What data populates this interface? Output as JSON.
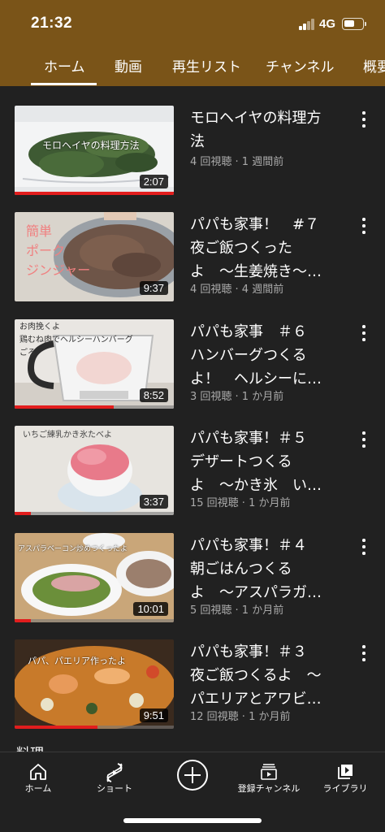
{
  "status_bar": {
    "time": "21:32",
    "network": "4G"
  },
  "tabs": [
    "ホーム",
    "動画",
    "再生リスト",
    "チャンネル",
    "概要"
  ],
  "videos": [
    {
      "title": "モロヘイヤの料理方\n法",
      "meta": "4 回視聴 · 1 週間前",
      "duration": "2:07",
      "progress": 1.0,
      "thumb_caption": "モロヘイヤの料理方法"
    },
    {
      "title": "パパも家事！　#７\n夜ご飯つくった\nよ　～生姜焼き～…",
      "meta": "4 回視聴 · 4 週間前",
      "duration": "9:37",
      "progress": 0.0,
      "thumb_caption": "簡単\nポーク\nジンジャー"
    },
    {
      "title": "パパも家事　＃６\nハンバーグつくる\nよ！　ヘルシーに…",
      "meta": "3 回視聴 · 1 か月前",
      "duration": "8:52",
      "progress": 0.62,
      "thumb_caption": "お肉挽くよ\n鶏むね肉でヘルシーハンバーグ\nごろ"
    },
    {
      "title": "パパも家事！＃５\nデザートつくる\nよ　～かき氷　い…",
      "meta": "15 回視聴 · 1 か月前",
      "duration": "3:37",
      "progress": 0.1,
      "thumb_caption": "いちご練乳かき氷たべよ"
    },
    {
      "title": "パパも家事！＃４\n朝ごはんつくる\nよ　～アスパラガ…",
      "meta": "5 回視聴 · 1 か月前",
      "duration": "10:01",
      "progress": 0.1,
      "thumb_caption": "アスパラベーコン炒めつくったよ"
    },
    {
      "title": "パパも家事！＃３\n夜ご飯つくるよ　～\nパエリアとアワビ…",
      "meta": "12 回視聴 · 1 か月前",
      "duration": "9:51",
      "progress": 0.52,
      "thumb_caption": "パパ、パエリア作ったよ"
    }
  ],
  "section_label": "料理",
  "bottom_nav": [
    {
      "label": "ホーム",
      "icon": "home-icon"
    },
    {
      "label": "ショート",
      "icon": "shorts-icon"
    },
    {
      "label": "",
      "icon": "create-icon"
    },
    {
      "label": "登録チャンネル",
      "icon": "subscriptions-icon"
    },
    {
      "label": "ライブラリ",
      "icon": "library-icon"
    }
  ],
  "colors": {
    "header": "#7a5418",
    "background": "#212121",
    "progress": "#e21d1d"
  }
}
